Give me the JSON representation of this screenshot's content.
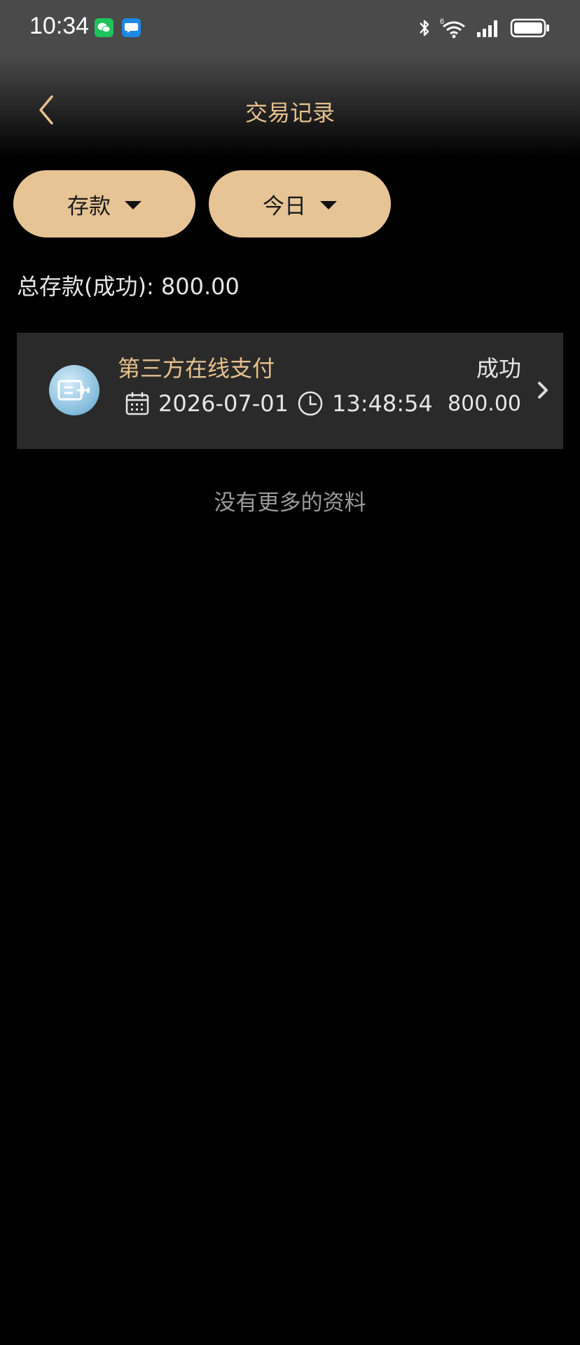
{
  "status_bar": {
    "time": "10:34",
    "left_icons": [
      "wechat-icon",
      "message-icon"
    ],
    "right_icons": [
      "bluetooth-icon",
      "wifi-icon",
      "signal-icon",
      "battery-icon"
    ],
    "wifi_label": "6"
  },
  "header": {
    "title": "交易记录",
    "back_icon": "chevron-left-icon"
  },
  "filters": {
    "type": {
      "label": "存款",
      "icon": "caret-down-icon"
    },
    "date_range": {
      "label": "今日",
      "icon": "caret-down-icon"
    }
  },
  "summary": {
    "text": "总存款(成功): 800.00"
  },
  "records": [
    {
      "method": "第三方在线支付",
      "status": "成功",
      "date": "2026-07-01",
      "time": "13:48:54",
      "amount": "800.00"
    }
  ],
  "footer": {
    "no_more_text": "没有更多的资料"
  },
  "colors": {
    "background": "#000000",
    "accent_gold": "#e6c18f",
    "pill_bg": "#e7c495",
    "card_bg": "#2a2a2a",
    "muted": "#9a9a9a"
  }
}
